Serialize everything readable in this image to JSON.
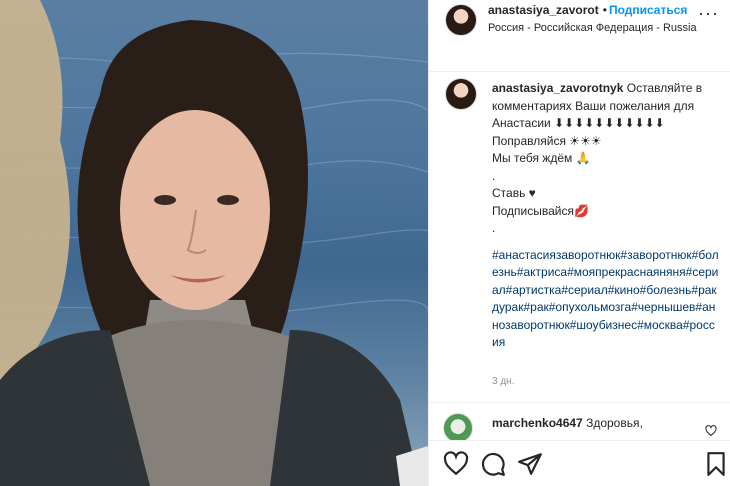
{
  "post_header": {
    "username": "anastasiya_zavorot",
    "separator": "•",
    "follow_label": "Подписаться",
    "location": "Россия - Российская Федерация - Russia",
    "more_label": "···"
  },
  "caption": {
    "username": "anastasiya_zavorotnyk",
    "text_first": " Оставляйте в комментариях Ваши пожелания для Анастасии ⬇⬇⬇⬇⬇⬇⬇⬇⬇⬇⬇",
    "line_get_well": "Поправляйся ☀☀☀",
    "line_waiting": "Мы тебя ждём 🙏",
    "dot1": ".",
    "line_like": "Ставь ♥",
    "line_subscribe": "Подписывайся💋",
    "dot2": ".",
    "hashtags": "#анастасиязаворотнюк#заворотнюк#болезнь#актриса#мояпрекраснаяняня#сериал#артистка#сериал#кино#болезнь#ракдурак#рак#опухольмозга#чернышев#аннозаворотнюк#шоубизнес#москва#россия",
    "time": "3 дн."
  },
  "comment": {
    "username": "marchenko4647",
    "text": " Здоровья,"
  },
  "colors": {
    "link_blue": "#0095f6",
    "hashtag_blue": "#00376b",
    "muted": "#8e8e8e",
    "text": "#262626"
  },
  "icons": {
    "like": "heart-icon",
    "comment": "comment-icon",
    "share": "paper-plane-icon",
    "save": "bookmark-icon",
    "more": "more-dots-icon",
    "comment_like": "small-heart-icon"
  }
}
